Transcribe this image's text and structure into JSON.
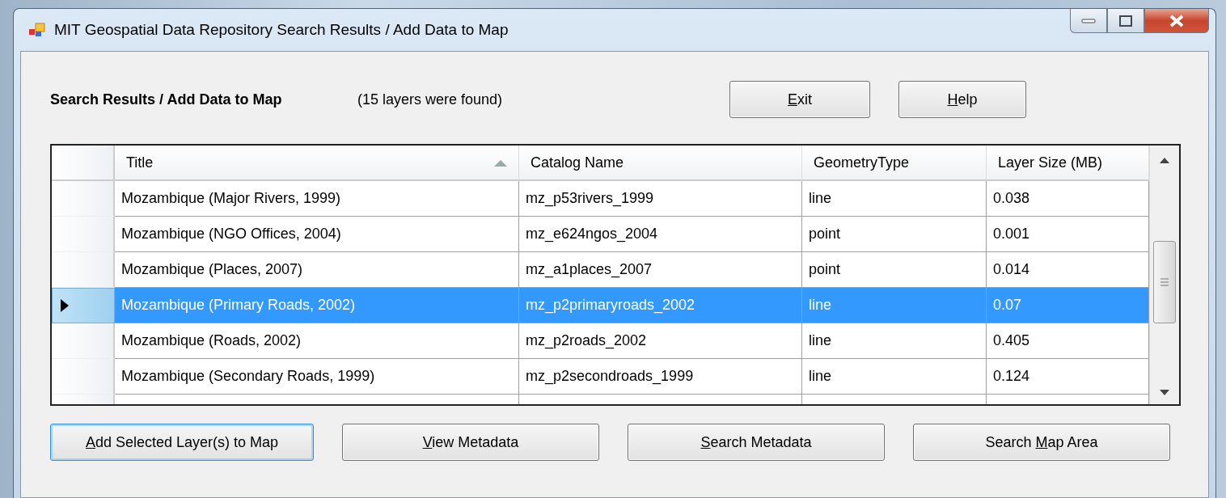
{
  "window": {
    "title": "MIT Geospatial Data Repository Search Results / Add Data to Map"
  },
  "heading": "Search Results / Add Data to Map",
  "result_count": "(15 layers were found)",
  "top_buttons": [
    {
      "label": {
        "key": "E",
        "after": "xit"
      }
    },
    {
      "label": {
        "key": "H",
        "after": "elp"
      }
    }
  ],
  "table": {
    "columns": [
      {
        "label": "Title",
        "sorted": true
      },
      {
        "label": "Catalog Name",
        "sorted": false
      },
      {
        "label": "GeometryType",
        "sorted": false
      },
      {
        "label": "Layer Size (MB)",
        "sorted": false
      }
    ],
    "rows": [
      {
        "selected": false,
        "cells": [
          "Mozambique (Major Rivers, 1999)",
          "mz_p53rivers_1999",
          "line",
          "0.038"
        ]
      },
      {
        "selected": false,
        "cells": [
          "Mozambique (NGO Offices, 2004)",
          "mz_e624ngos_2004",
          "point",
          "0.001"
        ]
      },
      {
        "selected": false,
        "cells": [
          "Mozambique (Places, 2007)",
          "mz_a1places_2007",
          "point",
          "0.014"
        ]
      },
      {
        "selected": true,
        "cells": [
          "Mozambique (Primary Roads, 2002)",
          "mz_p2primaryroads_2002",
          "line",
          "0.07"
        ]
      },
      {
        "selected": false,
        "cells": [
          "Mozambique (Roads, 2002)",
          "mz_p2roads_2002",
          "line",
          "0.405"
        ]
      },
      {
        "selected": false,
        "cells": [
          "Mozambique (Secondary Roads, 1999)",
          "mz_p2secondroads_1999",
          "line",
          "0.124"
        ]
      }
    ]
  },
  "bottom_buttons": [
    {
      "label": {
        "key": "A",
        "after": "dd Selected Layer(s) to Map"
      },
      "focused": true
    },
    {
      "label": {
        "key": "V",
        "after": "iew Metadata"
      },
      "focused": false
    },
    {
      "label": {
        "key": "S",
        "after": "earch Metadata"
      },
      "focused": false
    },
    {
      "label": {
        "before": "Search ",
        "key": "M",
        "after": "ap Area"
      },
      "focused": false
    }
  ]
}
